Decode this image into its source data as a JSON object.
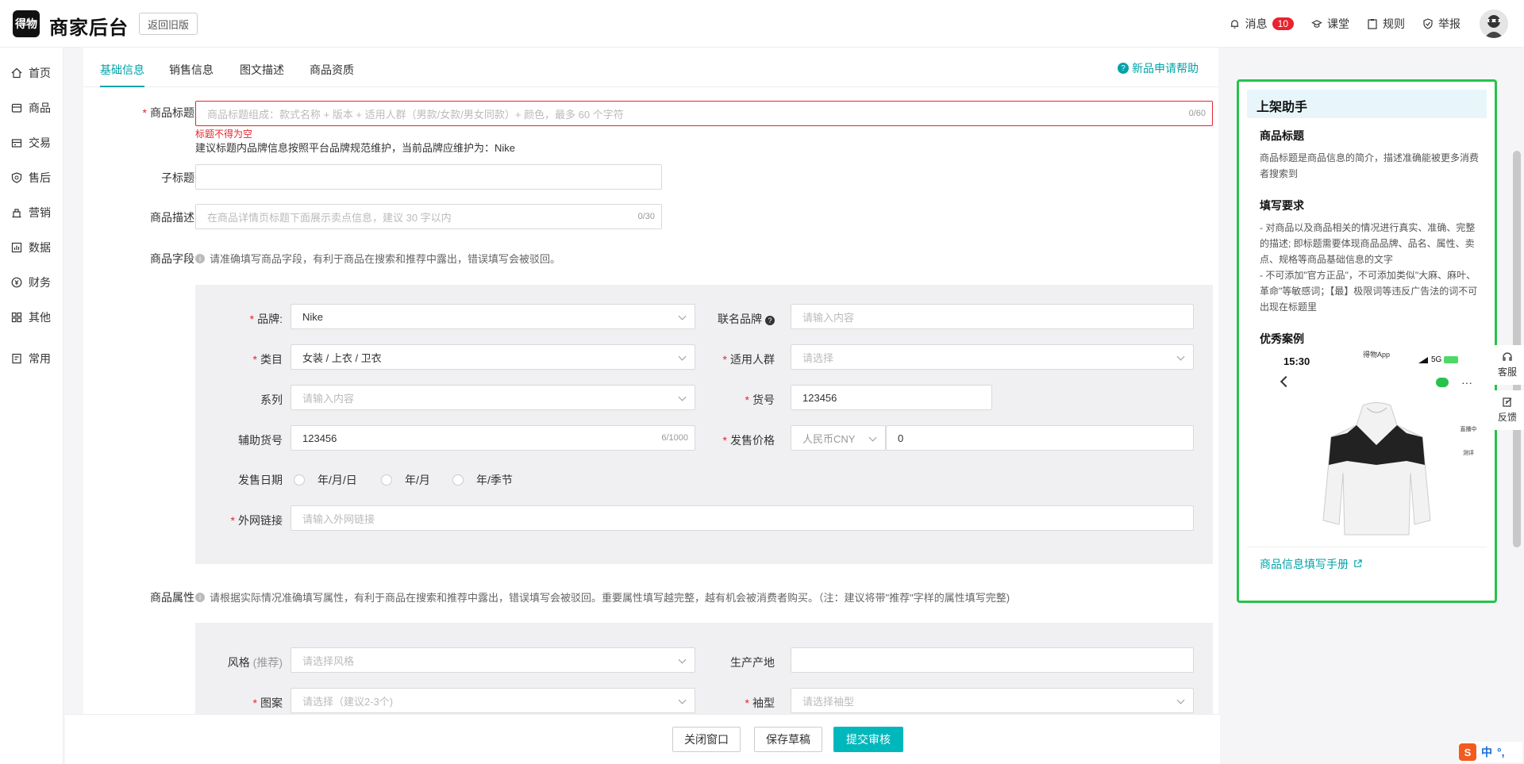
{
  "header": {
    "logo_text": "得物",
    "brand": "商家后台",
    "old_version": "返回旧版",
    "messages": "消息",
    "messages_count": "10",
    "classroom": "课堂",
    "rules": "规则",
    "report": "举报"
  },
  "sidebar": {
    "items": [
      {
        "label": "首页",
        "icon": "home-icon"
      },
      {
        "label": "商品",
        "icon": "product-icon"
      },
      {
        "label": "交易",
        "icon": "trade-icon"
      },
      {
        "label": "售后",
        "icon": "aftersale-icon"
      },
      {
        "label": "营销",
        "icon": "marketing-icon"
      },
      {
        "label": "数据",
        "icon": "data-icon"
      },
      {
        "label": "财务",
        "icon": "finance-icon"
      },
      {
        "label": "其他",
        "icon": "other-icon"
      },
      {
        "label": "常用",
        "icon": "common-icon"
      }
    ]
  },
  "tabs": [
    "基础信息",
    "销售信息",
    "图文描述",
    "商品资质"
  ],
  "help_link": "新品申请帮助",
  "form": {
    "title_label": "商品标题",
    "title_placeholder": "商品标题组成：款式名称 + 版本 + 适用人群（男款/女款/男女同款）+ 颜色，最多 60 个字符",
    "title_counter": "0/60",
    "title_error": "标题不得为空",
    "title_hint": "建议标题内品牌信息按照平台品牌规范维护，当前品牌应维护为：Nike",
    "subtitle_label": "子标题",
    "desc_label": "商品描述",
    "desc_placeholder": "在商品详情页标题下面展示卖点信息，建议 30 字以内",
    "desc_counter": "0/30",
    "fields_label": "商品字段",
    "fields_info": "请准确填写商品字段，有利于商品在搜索和推荐中露出，错误填写会被驳回。",
    "brand_label": "品牌:",
    "brand_value": "Nike",
    "cobrand_label": "联名品牌",
    "cobrand_placeholder": "请输入内容",
    "category_label": "类目",
    "category_value": "女装 / 上衣 / 卫衣",
    "audience_label": "适用人群",
    "audience_placeholder": "请选择",
    "series_label": "系列",
    "series_placeholder": "请输入内容",
    "sku_label": "货号",
    "sku_value": "123456",
    "aux_sku_label": "辅助货号",
    "aux_sku_value": "123456",
    "aux_sku_counter": "6/1000",
    "price_label": "发售价格",
    "currency": "人民币CNY",
    "price_value": "0",
    "release_label": "发售日期",
    "release_options": [
      "年/月/日",
      "年/月",
      "年/季节"
    ],
    "link_label": "外网链接",
    "link_placeholder": "请输入外网链接",
    "attrs_label": "商品属性",
    "attrs_info": "请根据实际情况准确填写属性，有利于商品在搜索和推荐中露出，错误填写会被驳回。重要属性填写越完整，越有机会被消费者购买。（注：建议将带\"推荐\"字样的属性填写完整)",
    "style_label": "风格",
    "style_tag": "(推荐)",
    "style_placeholder": "请选择风格",
    "origin_label": "生产产地",
    "pattern_label": "图案",
    "pattern_placeholder": "请选择（建议2-3个)",
    "sleeve_label": "袖型",
    "sleeve_placeholder": "请选择袖型"
  },
  "footer": {
    "close": "关闭窗口",
    "save": "保存草稿",
    "submit": "提交审核"
  },
  "assistant": {
    "title": "上架助手",
    "h1": "商品标题",
    "p1": "商品标题是商品信息的简介，描述准确能被更多消费者搜索到",
    "h2": "填写要求",
    "p2": "- 对商品以及商品相关的情况进行真实、准确、完整的描述; 即标题需要体现商品品牌、品名、属性、卖点、规格等商品基础信息的文字",
    "p3": "- 不可添加\"官方正品\"，不可添加类似\"大麻、麻叶、革命\"等敏感词；【最】极限词等违反广告法的词不可出现在标题里",
    "h3": "优秀案例",
    "phone_time": "15:30",
    "phone_app": "得物App",
    "phone_signal": "5G",
    "phone_live": "直播中",
    "phone_sign": "测评",
    "manual": "商品信息填写手册"
  },
  "floaters": {
    "service": "客服",
    "feedback": "反馈"
  },
  "ime": "中"
}
